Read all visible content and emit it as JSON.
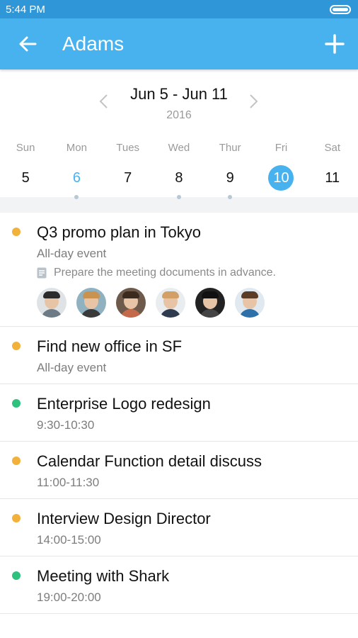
{
  "status_bar": {
    "time": "5:44 PM"
  },
  "app_bar": {
    "title": "Adams",
    "back_icon": "arrow-left-icon",
    "add_icon": "plus-icon"
  },
  "week": {
    "range": "Jun 5 - Jun 11",
    "year": "2016"
  },
  "days": [
    {
      "name": "Sun",
      "num": "5",
      "has_events": false,
      "state": "normal"
    },
    {
      "name": "Mon",
      "num": "6",
      "has_events": true,
      "state": "today"
    },
    {
      "name": "Tues",
      "num": "7",
      "has_events": false,
      "state": "normal"
    },
    {
      "name": "Wed",
      "num": "8",
      "has_events": true,
      "state": "normal"
    },
    {
      "name": "Thur",
      "num": "9",
      "has_events": true,
      "state": "normal"
    },
    {
      "name": "Fri",
      "num": "10",
      "has_events": false,
      "state": "selected"
    },
    {
      "name": "Sat",
      "num": "11",
      "has_events": false,
      "state": "normal"
    }
  ],
  "colors": {
    "accent": "#48b2ef",
    "status_bar": "#2f97d8",
    "orange": "#f2b13b",
    "green": "#2ec27e"
  },
  "events": [
    {
      "title": "Q3 promo plan in Tokyo",
      "time": "All-day event",
      "color": "#f2b13b",
      "note": "Prepare the meeting documents in advance.",
      "attendees": [
        {
          "name": "attendee-1"
        },
        {
          "name": "attendee-2"
        },
        {
          "name": "attendee-3"
        },
        {
          "name": "attendee-4"
        },
        {
          "name": "attendee-5"
        },
        {
          "name": "attendee-6"
        }
      ]
    },
    {
      "title": "Find new office in SF",
      "time": "All-day event",
      "color": "#f2b13b"
    },
    {
      "title": "Enterprise Logo redesign",
      "time": "9:30-10:30",
      "color": "#2ec27e"
    },
    {
      "title": "Calendar Function detail discuss",
      "time": "11:00-11:30",
      "color": "#f2b13b"
    },
    {
      "title": "Interview Design Director",
      "time": "14:00-15:00",
      "color": "#f2b13b"
    },
    {
      "title": "Meeting with Shark",
      "time": "19:00-20:00",
      "color": "#2ec27e"
    }
  ]
}
